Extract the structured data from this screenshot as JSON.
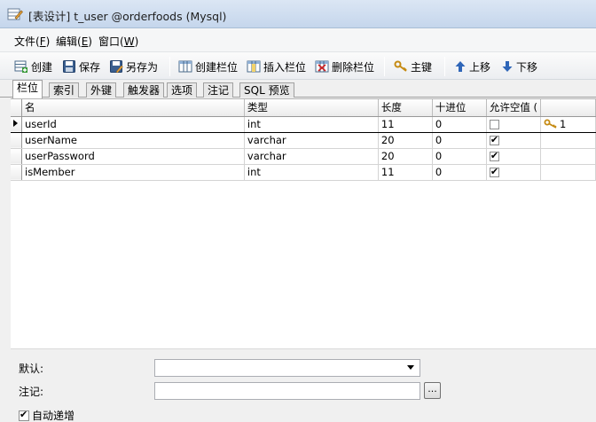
{
  "window": {
    "title": "[表设计] t_user @orderfoods (Mysql)"
  },
  "menu": [
    {
      "label": "文件(",
      "acc": "F",
      "tail": ")"
    },
    {
      "label": "编辑(",
      "acc": "E",
      "tail": ")"
    },
    {
      "label": "窗口(",
      "acc": "W",
      "tail": ")"
    }
  ],
  "toolbar": {
    "create": "创建",
    "save": "保存",
    "save_as": "另存为",
    "create_column": "创建栏位",
    "insert_column": "插入栏位",
    "delete_column": "删除栏位",
    "primary_key": "主键",
    "move_up": "上移",
    "move_down": "下移"
  },
  "tabs": [
    "栏位",
    "索引",
    "外键",
    "触发器",
    "选项",
    "注记",
    "SQL 预览"
  ],
  "grid": {
    "headers": [
      "名",
      "类型",
      "长度",
      "十进位",
      "允许空值 (",
      ""
    ],
    "rows": [
      {
        "name": "userId",
        "type": "int",
        "length": "11",
        "decimals": "0",
        "nullable": false,
        "key": "1"
      },
      {
        "name": "userName",
        "type": "varchar",
        "length": "20",
        "decimals": "0",
        "nullable": true,
        "key": ""
      },
      {
        "name": "userPassword",
        "type": "varchar",
        "length": "20",
        "decimals": "0",
        "nullable": true,
        "key": ""
      },
      {
        "name": "isMember",
        "type": "int",
        "length": "11",
        "decimals": "0",
        "nullable": true,
        "key": ""
      }
    ]
  },
  "properties": {
    "default_label": "默认:",
    "comment_label": "注记:",
    "dots": "...",
    "auto_increment_label": "自动递增",
    "auto_increment_checked": true
  }
}
